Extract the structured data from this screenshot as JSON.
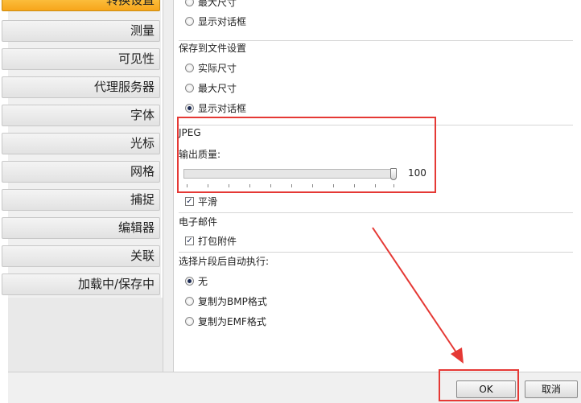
{
  "sidebar": {
    "items": [
      {
        "label": "转换设置",
        "active": true
      },
      {
        "label": "测量"
      },
      {
        "label": "可见性"
      },
      {
        "label": "代理服务器"
      },
      {
        "label": "字体"
      },
      {
        "label": "光标"
      },
      {
        "label": "网格"
      },
      {
        "label": "捕捉"
      },
      {
        "label": "编辑器"
      },
      {
        "label": "关联"
      },
      {
        "label": "加载中/保存中"
      }
    ]
  },
  "top_group": {
    "options": [
      {
        "label": "最大尺寸",
        "selected": false
      },
      {
        "label": "显示对话框",
        "selected": false
      }
    ]
  },
  "save_to_file": {
    "title": "保存到文件设置",
    "options": [
      {
        "label": "实际尺寸",
        "selected": false
      },
      {
        "label": "最大尺寸",
        "selected": false
      },
      {
        "label": "显示对话框",
        "selected": true
      }
    ]
  },
  "jpeg": {
    "title": "JPEG",
    "quality_label": "输出质量:",
    "quality_value": "100",
    "quality_fraction": 1.0,
    "smooth_label": "平滑",
    "smooth_checked": true
  },
  "email": {
    "title": "电子邮件",
    "pack_label": "打包附件",
    "pack_checked": true
  },
  "after_select": {
    "title": "选择片段后自动执行:",
    "options": [
      {
        "label": "无",
        "selected": true
      },
      {
        "label": "复制为BMP格式",
        "selected": false
      },
      {
        "label": "复制为EMF格式",
        "selected": false
      }
    ]
  },
  "footer": {
    "ok_label": "OK",
    "cancel_label": "取消"
  },
  "colors": {
    "highlight": "#e53935",
    "active_item": "#f7a51a"
  }
}
